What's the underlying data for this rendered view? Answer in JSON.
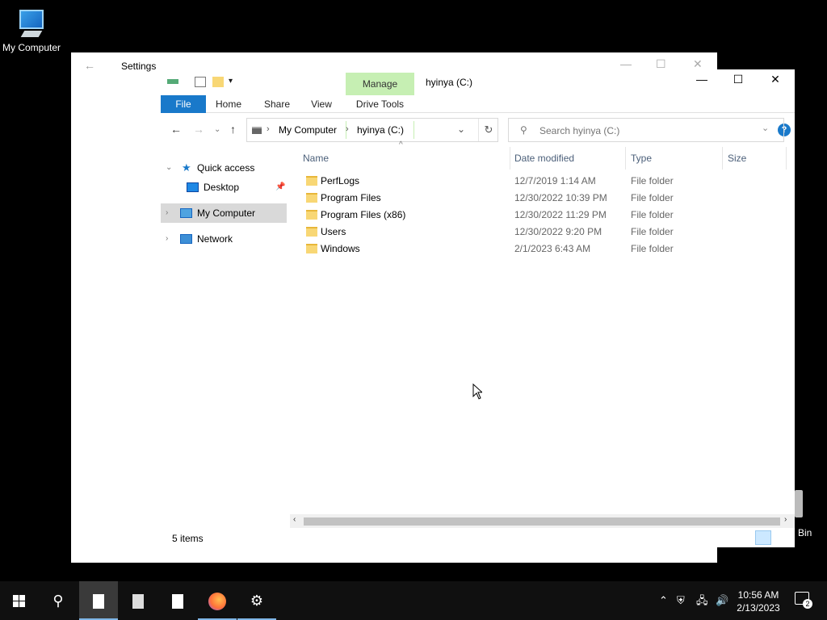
{
  "desktop": {
    "icon_my_computer": "My Computer",
    "icon_recycle_bin_partial": "Bin"
  },
  "settings_window": {
    "title": "Settings"
  },
  "explorer": {
    "title": "hyinya (C:)",
    "ribbon": {
      "tabs": [
        "File",
        "Home",
        "Share",
        "View"
      ],
      "context_group": "Manage",
      "context_tab": "Drive Tools"
    },
    "address": {
      "segments": [
        "My Computer",
        "hyinya (C:)"
      ]
    },
    "search": {
      "placeholder": "Search hyinya (C:)"
    },
    "nav_pane": {
      "quick_access": "Quick access",
      "desktop": "Desktop",
      "my_computer": "My Computer",
      "network": "Network"
    },
    "columns": {
      "name": "Name",
      "date": "Date modified",
      "type": "Type",
      "size": "Size"
    },
    "rows": [
      {
        "name": "PerfLogs",
        "date": "12/7/2019 1:14 AM",
        "type": "File folder"
      },
      {
        "name": "Program Files",
        "date": "12/30/2022 10:39 PM",
        "type": "File folder"
      },
      {
        "name": "Program Files (x86)",
        "date": "12/30/2022 11:29 PM",
        "type": "File folder"
      },
      {
        "name": "Users",
        "date": "12/30/2022 9:20 PM",
        "type": "File folder"
      },
      {
        "name": "Windows",
        "date": "2/1/2023 6:43 AM",
        "type": "File folder"
      }
    ],
    "status": {
      "items": "5 items"
    }
  },
  "taskbar": {
    "time": "10:56 AM",
    "date": "2/13/2023",
    "notification_count": "2"
  },
  "colors": {
    "accent": "#1979ca",
    "manage_tab": "#c6efb3",
    "folder": "#f8d775"
  }
}
